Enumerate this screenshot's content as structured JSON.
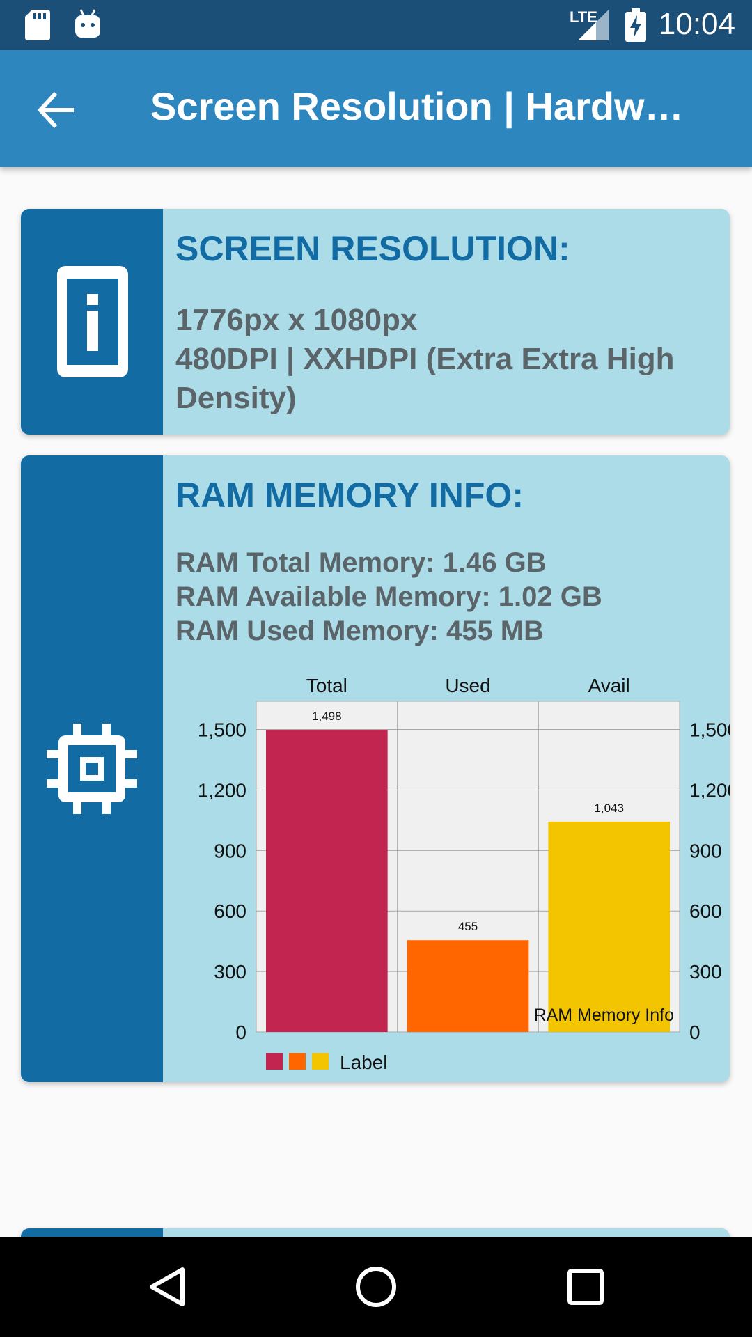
{
  "status_bar": {
    "time": "10:04",
    "network": "LTE",
    "icons": [
      "sd-card-icon",
      "android-debug-icon",
      "lte-signal-icon",
      "battery-charging-icon"
    ]
  },
  "app_bar": {
    "title": "Screen Resolution | Hardware",
    "back_icon": "arrow-back-icon"
  },
  "screen_card": {
    "title": "SCREEN RESOLUTION:",
    "line1": "1776px x 1080px",
    "line2": "480DPI | XXHDPI (Extra Extra High Density)",
    "icon": "phone-info-icon"
  },
  "ram_card": {
    "title": "RAM MEMORY INFO:",
    "line1": "RAM Total Memory: 1.46 GB",
    "line2": "RAM Available Memory: 1.02 GB",
    "line3": "RAM Used Memory: 455 MB",
    "icon": "chip-icon"
  },
  "chart_data": {
    "type": "bar",
    "categories": [
      "Total",
      "Used",
      "Avail"
    ],
    "values": [
      1498,
      455,
      1043
    ],
    "value_labels": [
      "1,498",
      "455",
      "1,043"
    ],
    "colors": [
      "#c2254f",
      "#ff6600",
      "#f2c500"
    ],
    "ylim": [
      0,
      1640
    ],
    "yticks": [
      "0",
      "300",
      "600",
      "900",
      "1,200",
      "1,500"
    ],
    "ytick_values": [
      0,
      300,
      600,
      900,
      1200,
      1500
    ],
    "description": "RAM Memory Info",
    "legend_label": "Label",
    "grid": true,
    "axes": "left-and-right"
  },
  "nav_bar": {
    "icons": [
      "back-triangle-icon",
      "home-circle-icon",
      "recents-square-icon"
    ]
  }
}
